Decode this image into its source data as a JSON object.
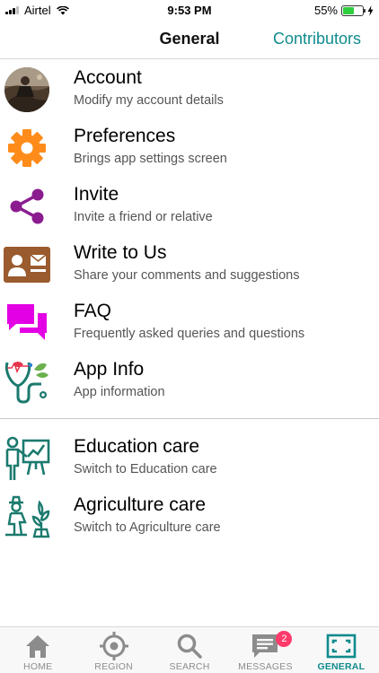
{
  "status_bar": {
    "carrier": "Airtel",
    "time": "9:53 PM",
    "battery_percent": "55%",
    "battery_level": 0.55
  },
  "header": {
    "title": "General",
    "action_label": "Contributors"
  },
  "menu": {
    "account": {
      "title": "Account",
      "subtitle": "Modify my account details",
      "icon": "user-avatar"
    },
    "preferences": {
      "title": "Preferences",
      "subtitle": "Brings app settings screen",
      "icon": "gear-icon"
    },
    "invite": {
      "title": "Invite",
      "subtitle": "Invite a friend or relative",
      "icon": "share-icon"
    },
    "write_to_us": {
      "title": "Write to Us",
      "subtitle": "Share your comments and suggestions",
      "icon": "contact-card-icon"
    },
    "faq": {
      "title": "FAQ",
      "subtitle": "Frequently asked queries and questions",
      "icon": "chat-bubbles-icon"
    },
    "app_info": {
      "title": "App Info",
      "subtitle": "App information",
      "icon": "stethoscope-icon"
    },
    "education": {
      "title": "Education care",
      "subtitle": "Switch to Education care",
      "icon": "teacher-icon"
    },
    "agriculture": {
      "title": "Agriculture care",
      "subtitle": "Switch to Agriculture care",
      "icon": "farmer-icon"
    }
  },
  "tabs": {
    "home": {
      "label": "HOME",
      "icon": "home-icon"
    },
    "region": {
      "label": "REGION",
      "icon": "target-icon"
    },
    "search": {
      "label": "SEARCH",
      "icon": "search-icon"
    },
    "messages": {
      "label": "MESSAGES",
      "icon": "message-icon",
      "badge": "2"
    },
    "general": {
      "label": "GENERAL",
      "icon": "fullscreen-icon"
    }
  },
  "colors": {
    "accent": "#108b8d",
    "gear": "#ff8c1a",
    "share": "#8a1c8f",
    "faq": "#e400e4",
    "card": "#9a5b2e",
    "teal_line": "#1b7a6e",
    "badge": "#ff3b6b"
  }
}
